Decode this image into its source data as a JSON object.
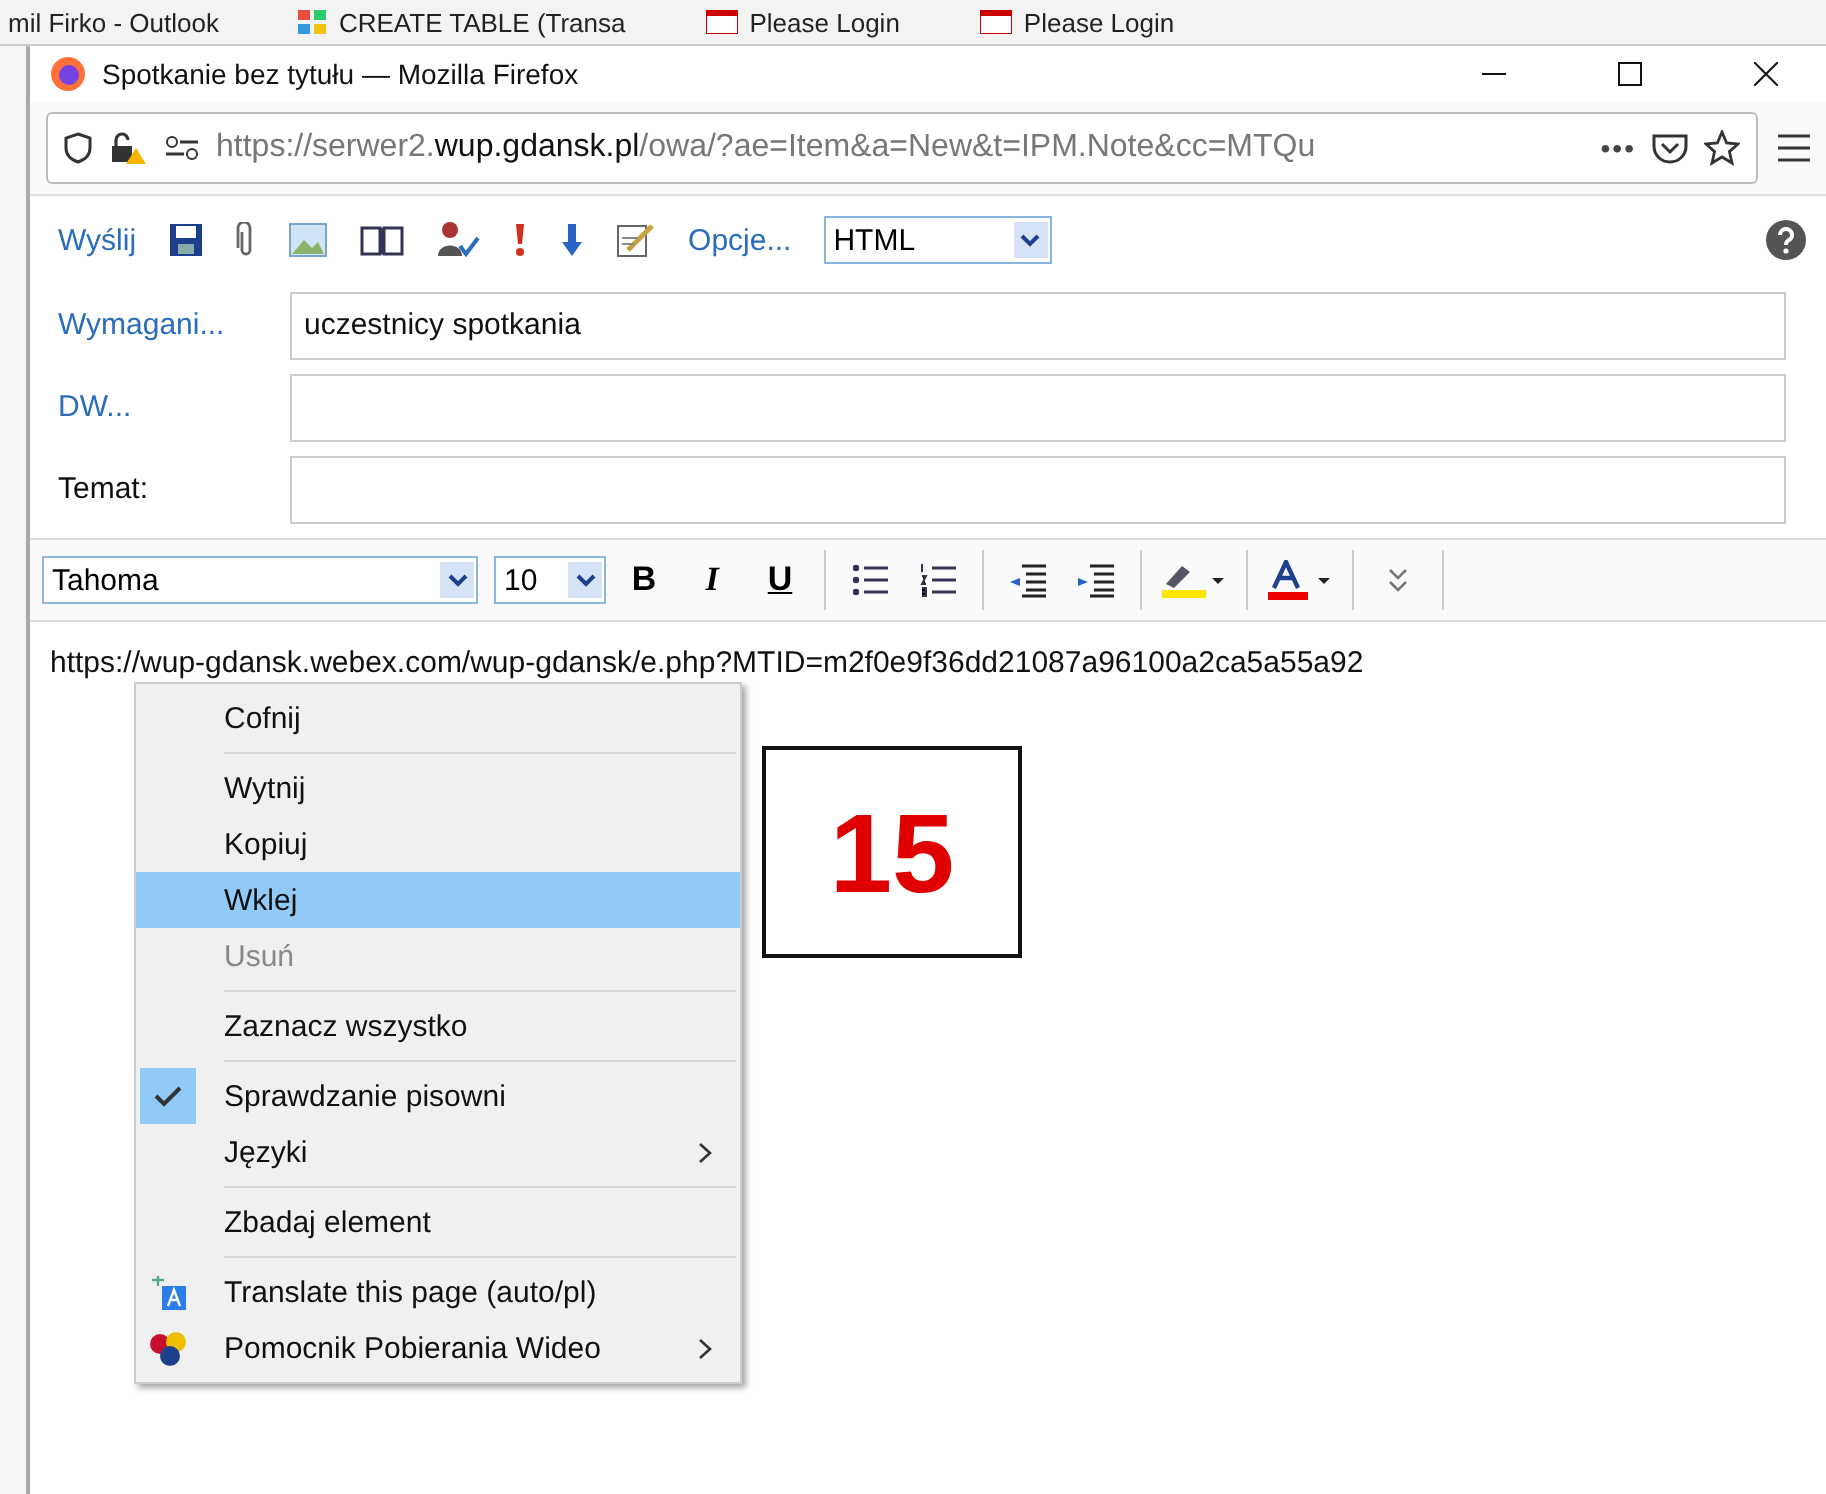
{
  "background_tabs": [
    {
      "label": "mil Firko - Outlook"
    },
    {
      "label": "CREATE TABLE (Transa"
    },
    {
      "label": "Please Login"
    },
    {
      "label": "Please Login"
    }
  ],
  "window": {
    "title": "Spotkanie bez tytułu — Mozilla Firefox"
  },
  "address_bar": {
    "url_prefix": "https://serwer2.",
    "url_domain": "wup.gdansk.pl",
    "url_rest": "/owa/?ae=Item&a=New&t=IPM.Note&cc=MTQu",
    "more": "•••"
  },
  "toolbar": {
    "send": "Wyślij",
    "options": "Opcje...",
    "format": "HTML"
  },
  "fields": [
    {
      "label": "Wymagani...",
      "kind": "link",
      "value": "uczestnicy spotkania"
    },
    {
      "label": "DW...",
      "kind": "link"
    },
    {
      "label": "Temat:",
      "kind": "plain"
    }
  ],
  "format_bar": {
    "font": "Tahoma",
    "size": "10",
    "bold": "B",
    "italic": "I",
    "underline": "U"
  },
  "body": {
    "text": "https://wup-gdansk.webex.com/wup-gdansk/e.php?MTID=m2f0e9f36dd21087a96100a2ca5a55a92"
  },
  "overlay_box": {
    "text": "15"
  },
  "context_menu": [
    {
      "kind": "item",
      "label": "Cofnij",
      "selected": false,
      "disabled": false,
      "checked": false,
      "submenu": false
    },
    {
      "kind": "separator"
    },
    {
      "kind": "item",
      "label": "Wytnij",
      "selected": false,
      "disabled": false,
      "checked": false,
      "submenu": false
    },
    {
      "kind": "item",
      "label": "Kopiuj",
      "selected": false,
      "disabled": false,
      "checked": false,
      "submenu": false
    },
    {
      "kind": "item",
      "label": "Wklej",
      "selected": true,
      "disabled": false,
      "checked": false,
      "submenu": false
    },
    {
      "kind": "item",
      "label": "Usuń",
      "selected": false,
      "disabled": true,
      "checked": false,
      "submenu": false
    },
    {
      "kind": "separator"
    },
    {
      "kind": "item",
      "label": "Zaznacz wszystko",
      "selected": false,
      "disabled": false,
      "checked": false,
      "submenu": false
    },
    {
      "kind": "separator"
    },
    {
      "kind": "item",
      "label": "Sprawdzanie pisowni",
      "selected": false,
      "disabled": false,
      "checked": true,
      "submenu": false
    },
    {
      "kind": "item",
      "label": "Języki",
      "selected": false,
      "disabled": false,
      "checked": false,
      "submenu": true
    },
    {
      "kind": "separator"
    },
    {
      "kind": "item",
      "label": "Zbadaj element",
      "selected": false,
      "disabled": false,
      "checked": false,
      "submenu": false
    },
    {
      "kind": "separator"
    },
    {
      "kind": "addon",
      "label": "Translate this page (auto/pl)",
      "selected": false,
      "disabled": false,
      "checked": false,
      "submenu": false
    },
    {
      "kind": "addon",
      "label": "Pomocnik Pobierania Wideo",
      "selected": false,
      "disabled": false,
      "checked": false,
      "submenu": true
    }
  ]
}
